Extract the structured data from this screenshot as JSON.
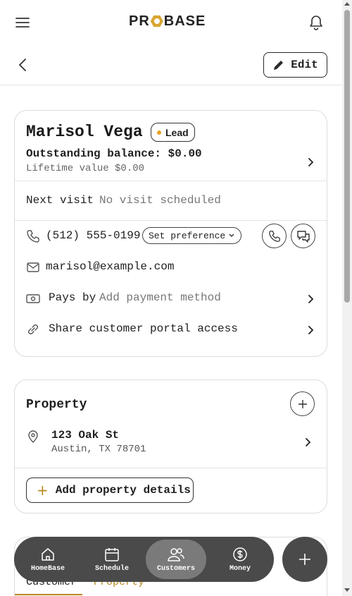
{
  "header": {
    "logo_left": "PR",
    "logo_right": "BASE",
    "edit_label": "Edit"
  },
  "customer": {
    "name": "Marisol Vega",
    "status_badge": "Lead",
    "outstanding_balance": "Outstanding balance: $0.00",
    "lifetime_value": "Lifetime value $0.00",
    "next_visit_label": "Next visit",
    "next_visit_value": "No visit scheduled",
    "phone": "(512) 555-0199",
    "preference_label": "Set preference",
    "email": "marisol@example.com",
    "pays_by_label": "Pays by",
    "pays_by_value": "Add payment method",
    "portal_label": "Share customer portal access"
  },
  "property": {
    "title": "Property",
    "address_line1": "123 Oak St",
    "address_line2": "Austin, TX 78701",
    "add_details_label": "Add property details"
  },
  "tabs": [
    {
      "label": "Customer"
    },
    {
      "label": "Property"
    }
  ],
  "nav": [
    {
      "label": "HomeBase",
      "icon": "home-icon"
    },
    {
      "label": "Schedule",
      "icon": "calendar-icon"
    },
    {
      "label": "Customers",
      "icon": "users-icon",
      "active": true
    },
    {
      "label": "Money",
      "icon": "dollar-icon"
    }
  ],
  "colors": {
    "accent": "#b8891e",
    "lead_dot": "#e8a020",
    "nav_bg": "#4a4a4a"
  }
}
